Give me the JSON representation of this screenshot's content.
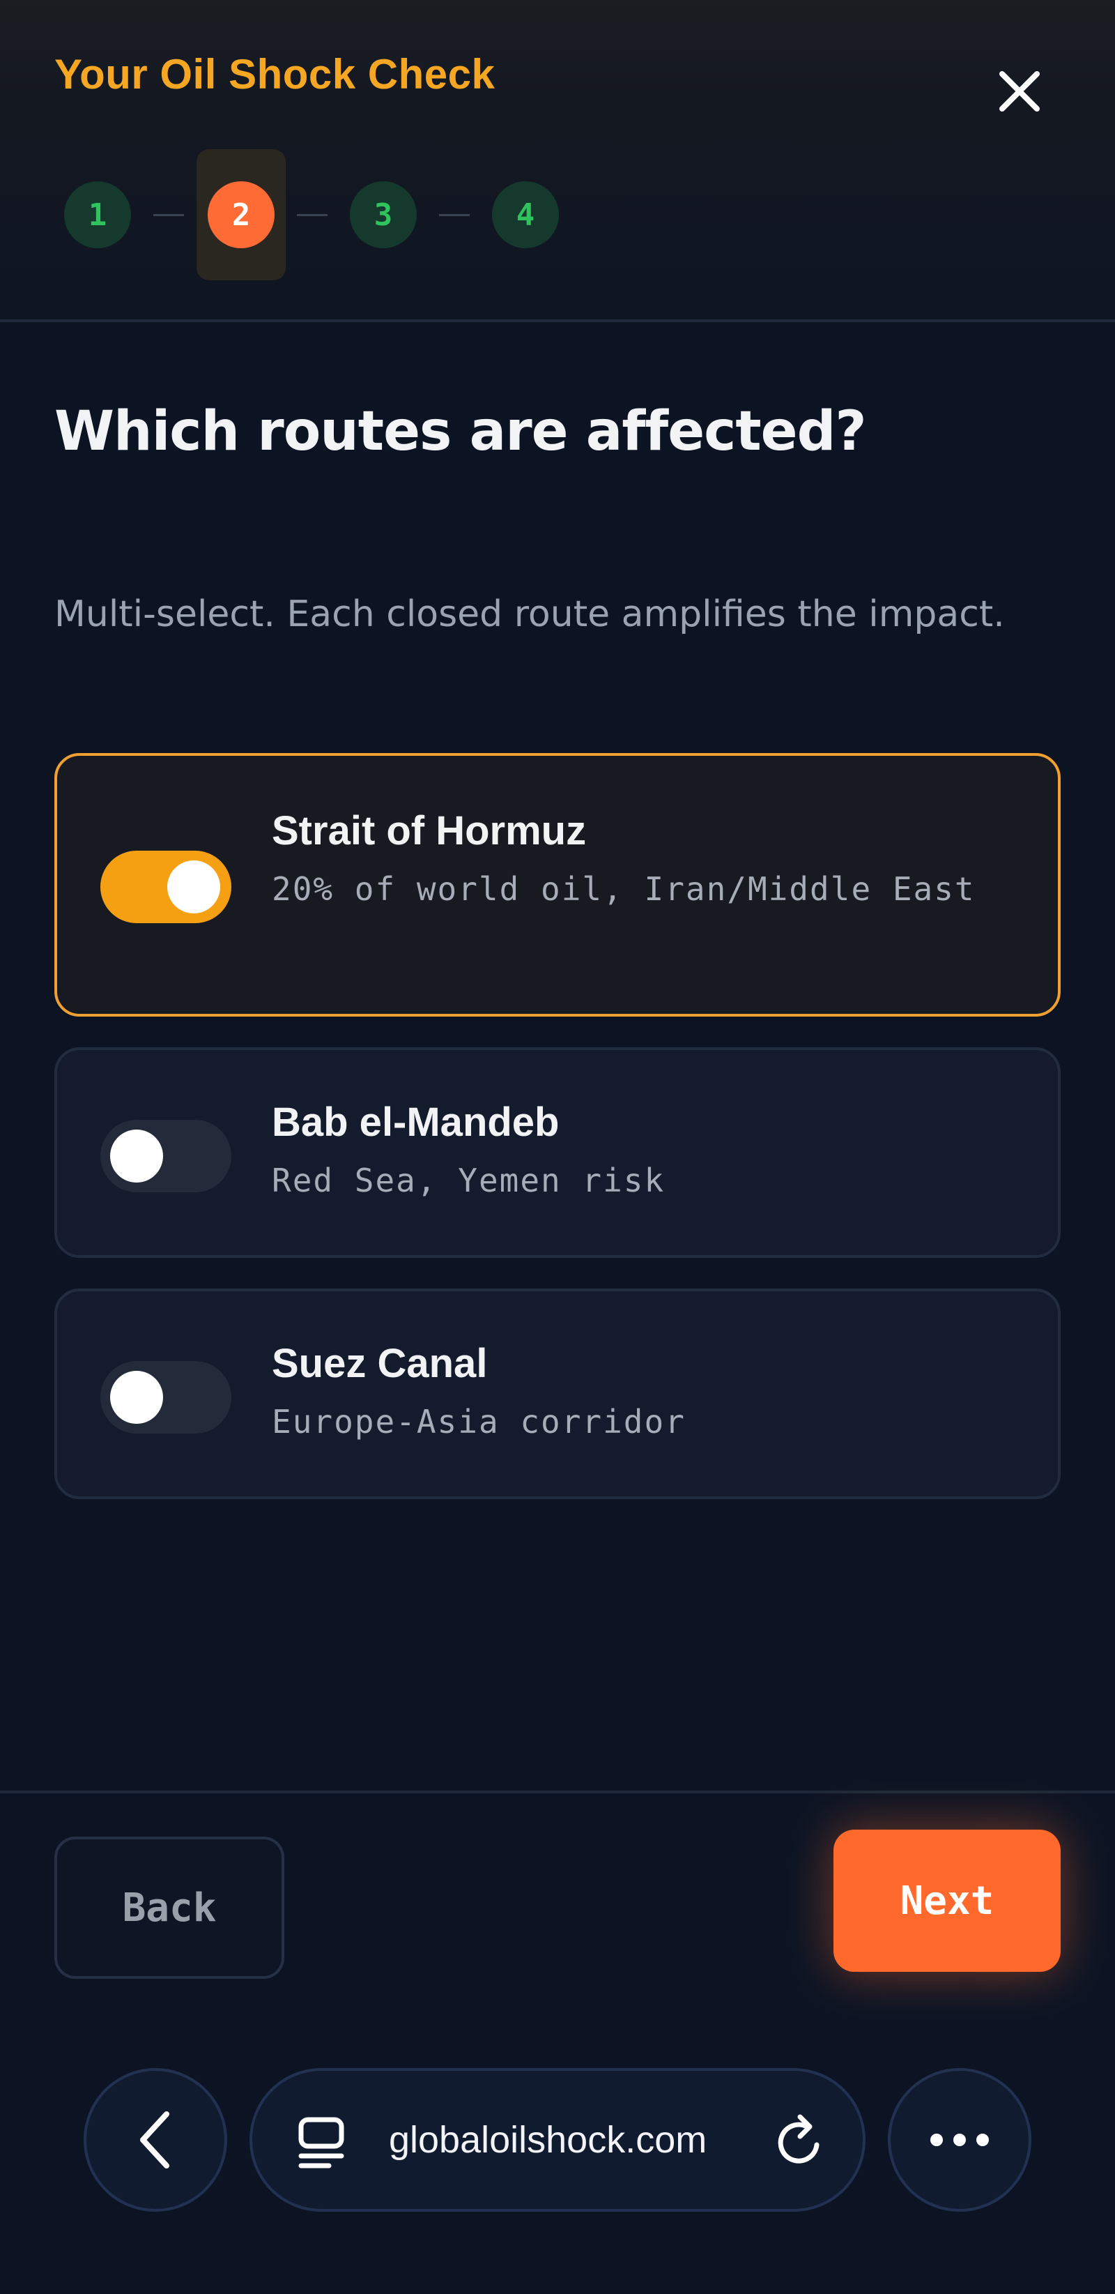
{
  "header": {
    "title": "Your Oil Shock Check",
    "steps": [
      {
        "label": "1",
        "state": "complete"
      },
      {
        "label": "2",
        "state": "active"
      },
      {
        "label": "3",
        "state": "complete"
      },
      {
        "label": "4",
        "state": "complete"
      }
    ],
    "close_icon": "close-icon"
  },
  "main": {
    "question": "Which routes are affected?",
    "hint": "Multi-select. Each closed route amplifies the impact.",
    "routes": [
      {
        "name": "Strait of Hormuz",
        "description": "20% of world oil, Iran/Middle East",
        "selected": true
      },
      {
        "name": "Bab el-Mandeb",
        "description": "Red Sea, Yemen risk",
        "selected": false
      },
      {
        "name": "Suez Canal",
        "description": "Europe-Asia corridor",
        "selected": false
      }
    ]
  },
  "footer": {
    "back_label": "Back",
    "next_label": "Next"
  },
  "browser": {
    "url": "globaloilshock.com",
    "back_icon": "chevron-left-icon",
    "page_icon": "page-icon",
    "reload_icon": "reload-icon",
    "more_icon": "more-icon"
  },
  "colors": {
    "accent": "#f5a623",
    "primary_button": "#ff6a2c",
    "step_complete": "#2fc25d",
    "background": "#0c1424"
  }
}
